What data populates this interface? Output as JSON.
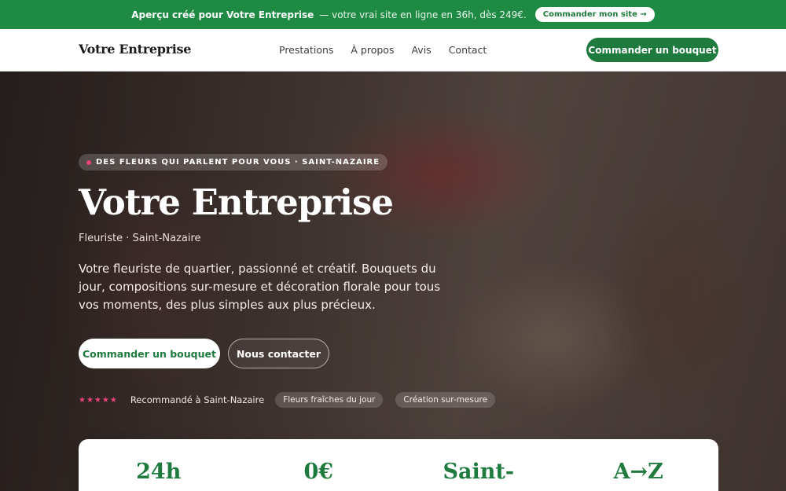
{
  "promo": {
    "bold": "Aperçu créé pour Votre Entreprise",
    "rest": "— votre vrai site en ligne en 36h, dès 249€.",
    "cta": "Commander mon site →"
  },
  "header": {
    "logo": "Votre Entreprise",
    "nav": [
      "Prestations",
      "À propos",
      "Avis",
      "Contact"
    ],
    "cta": "Commander un bouquet"
  },
  "hero": {
    "badge": "DES FLEURS QUI PARLENT POUR VOUS · SAINT-NAZAIRE",
    "title": "Votre Entreprise",
    "subtitle": "Fleuriste · Saint-Nazaire",
    "description": "Votre fleuriste de quartier, passionné et créatif. Bouquets du jour, compositions sur-mesure et décoration florale pour tous vos moments, des plus simples aux plus précieux.",
    "primary_button": "Commander un bouquet",
    "secondary_button": "Nous contacter",
    "stars": "★★★★★",
    "rating_text": "Recommandé à Saint-Nazaire",
    "pills": [
      "Fleurs fraîches du jour",
      "Création sur-mesure"
    ]
  },
  "stats": [
    "24h",
    "0€",
    "Saint-",
    "A→Z"
  ],
  "colors": {
    "brand_green": "#1f7a3d",
    "promo_green": "#1e8a43",
    "accent_pink": "#e8437a"
  }
}
